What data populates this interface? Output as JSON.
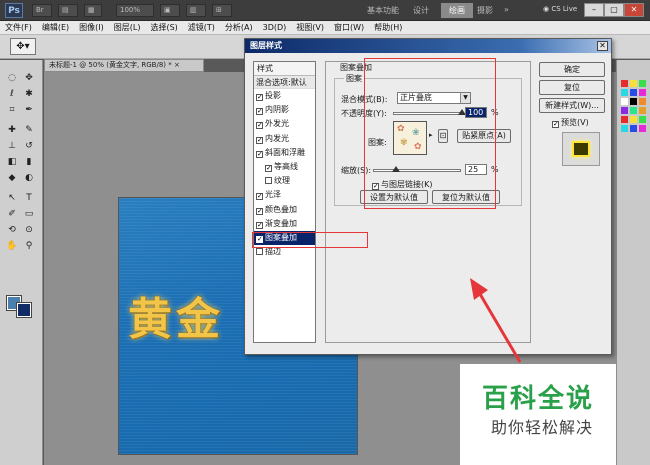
{
  "app": {
    "logo": "Ps",
    "zoom": "100%",
    "workspaces": [
      "基本功能",
      "设计",
      "绘画",
      "摄影"
    ],
    "active_workspace": "绘画",
    "overflow": "»",
    "cs_live": "CS Live",
    "win_min": "–",
    "win_restore": "▢",
    "win_close": "✕"
  },
  "menu": [
    "文件(F)",
    "编辑(E)",
    "图像(I)",
    "图层(L)",
    "选择(S)",
    "滤镜(T)",
    "分析(A)",
    "3D(D)",
    "视图(V)",
    "窗口(W)",
    "帮助(H)"
  ],
  "document": {
    "tab": "未标题-1 @ 50% (黄金文字, RGB/8) *",
    "tab_close": "×",
    "canvas_text": "黄金"
  },
  "dialog": {
    "title": "图层样式",
    "close": "✕",
    "styles_header": "样式",
    "blend_options": "混合选项:默认",
    "styles": [
      {
        "label": "投影",
        "checked": true
      },
      {
        "label": "内阴影",
        "checked": true
      },
      {
        "label": "外发光",
        "checked": true
      },
      {
        "label": "内发光",
        "checked": true
      },
      {
        "label": "斜面和浮雕",
        "checked": true
      },
      {
        "label": "等高线",
        "checked": true,
        "sub": true
      },
      {
        "label": "纹理",
        "checked": false,
        "sub": true
      },
      {
        "label": "光泽",
        "checked": true
      },
      {
        "label": "颜色叠加",
        "checked": true
      },
      {
        "label": "渐变叠加",
        "checked": true
      },
      {
        "label": "图案叠加",
        "checked": true,
        "selected": true
      },
      {
        "label": "描边",
        "checked": false
      }
    ],
    "section_title": "图案叠加",
    "subsection_title": "图案",
    "blend_mode_label": "混合模式(B):",
    "blend_mode_value": "正片叠底",
    "opacity_label": "不透明度(Y):",
    "opacity_value": "100",
    "opacity_level": 1.0,
    "percent": "%",
    "pattern_label": "图案:",
    "snap_button": "贴紧原点(A)",
    "scale_label": "缩放(S):",
    "scale_value": "25",
    "scale_level": 0.25,
    "link_label": "与图层链接(K)",
    "link_checked": true,
    "default_set": "设置为默认值",
    "default_reset": "复位为默认值",
    "ok": "确定",
    "cancel": "复位",
    "new_style": "新建样式(W)...",
    "preview_label": "预览(V)",
    "preview_checked": true
  },
  "watermark": {
    "title": "百科全说",
    "subtitle": "助你轻松解决"
  },
  "icons": {
    "move": "move-icon",
    "dropdown": "chevron-down-icon",
    "check": "✓"
  }
}
